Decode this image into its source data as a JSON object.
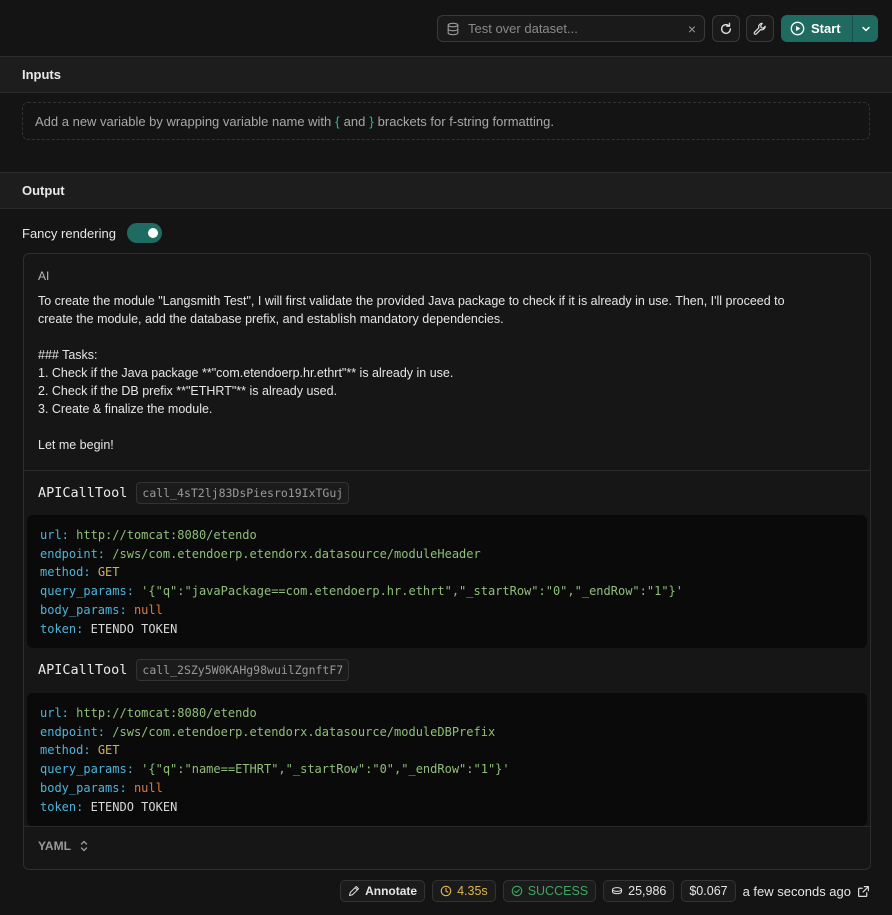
{
  "toolbar": {
    "dataset_placeholder": "Test over dataset...",
    "clear_label": "×",
    "start_label": "Start"
  },
  "inputs": {
    "header": "Inputs",
    "hint_before": "Add a new variable by wrapping variable name with",
    "open_brace": "{",
    "and": "and",
    "close_brace": "}",
    "hint_after": "brackets for f-string formatting."
  },
  "output": {
    "header": "Output",
    "fancy_label": "Fancy rendering",
    "fancy_enabled": true,
    "role": "AI",
    "message_lines": [
      "To create the module \"Langsmith Test\", I will first validate the provided Java package to check if it is already in use. Then, I'll proceed to",
      "create the module, add the database prefix, and establish mandatory dependencies.",
      "",
      "### Tasks:",
      "1. Check if the Java package **\"com.etendoerp.hr.ethrt\"** is already in use.",
      "2. Check if the DB prefix **\"ETHRT\"** is already used.",
      "3. Create & finalize the module.",
      "",
      "Let me begin!"
    ],
    "tool_calls": [
      {
        "name": "APICallTool",
        "id": "call_4sT2lj83DsPiesro19IxTGuj",
        "args": {
          "url_key": "url:",
          "url": "http://tomcat:8080/etendo",
          "endpoint_key": "endpoint:",
          "endpoint": "/sws/com.etendoerp.etendorx.datasource/moduleHeader",
          "method_key": "method:",
          "method": "GET",
          "query_key": "query_params:",
          "query": "'{\"q\":\"javaPackage==com.etendoerp.hr.ethrt\",\"_startRow\":\"0\",\"_endRow\":\"1\"}'",
          "body_key": "body_params:",
          "body": "null",
          "token_key": "token:",
          "token": "ETENDO TOKEN"
        }
      },
      {
        "name": "APICallTool",
        "id": "call_2SZy5W0KAHg98wuilZgnftF7",
        "args": {
          "url_key": "url:",
          "url": "http://tomcat:8080/etendo",
          "endpoint_key": "endpoint:",
          "endpoint": "/sws/com.etendoerp.etendorx.datasource/moduleDBPrefix",
          "method_key": "method:",
          "method": "GET",
          "query_key": "query_params:",
          "query": "'{\"q\":\"name==ETHRT\",\"_startRow\":\"0\",\"_endRow\":\"1\"}'",
          "body_key": "body_params:",
          "body": "null",
          "token_key": "token:",
          "token": "ETENDO TOKEN"
        }
      }
    ],
    "format_label": "YAML"
  },
  "footer": {
    "annotate_label": "Annotate",
    "latency": "4.35s",
    "status": "SUCCESS",
    "tokens": "25,986",
    "cost": "$0.067",
    "timestamp": "a few seconds ago"
  },
  "colors": {
    "accent": "#1f6b62",
    "success": "#3ea862",
    "latency": "#e0b64a"
  }
}
